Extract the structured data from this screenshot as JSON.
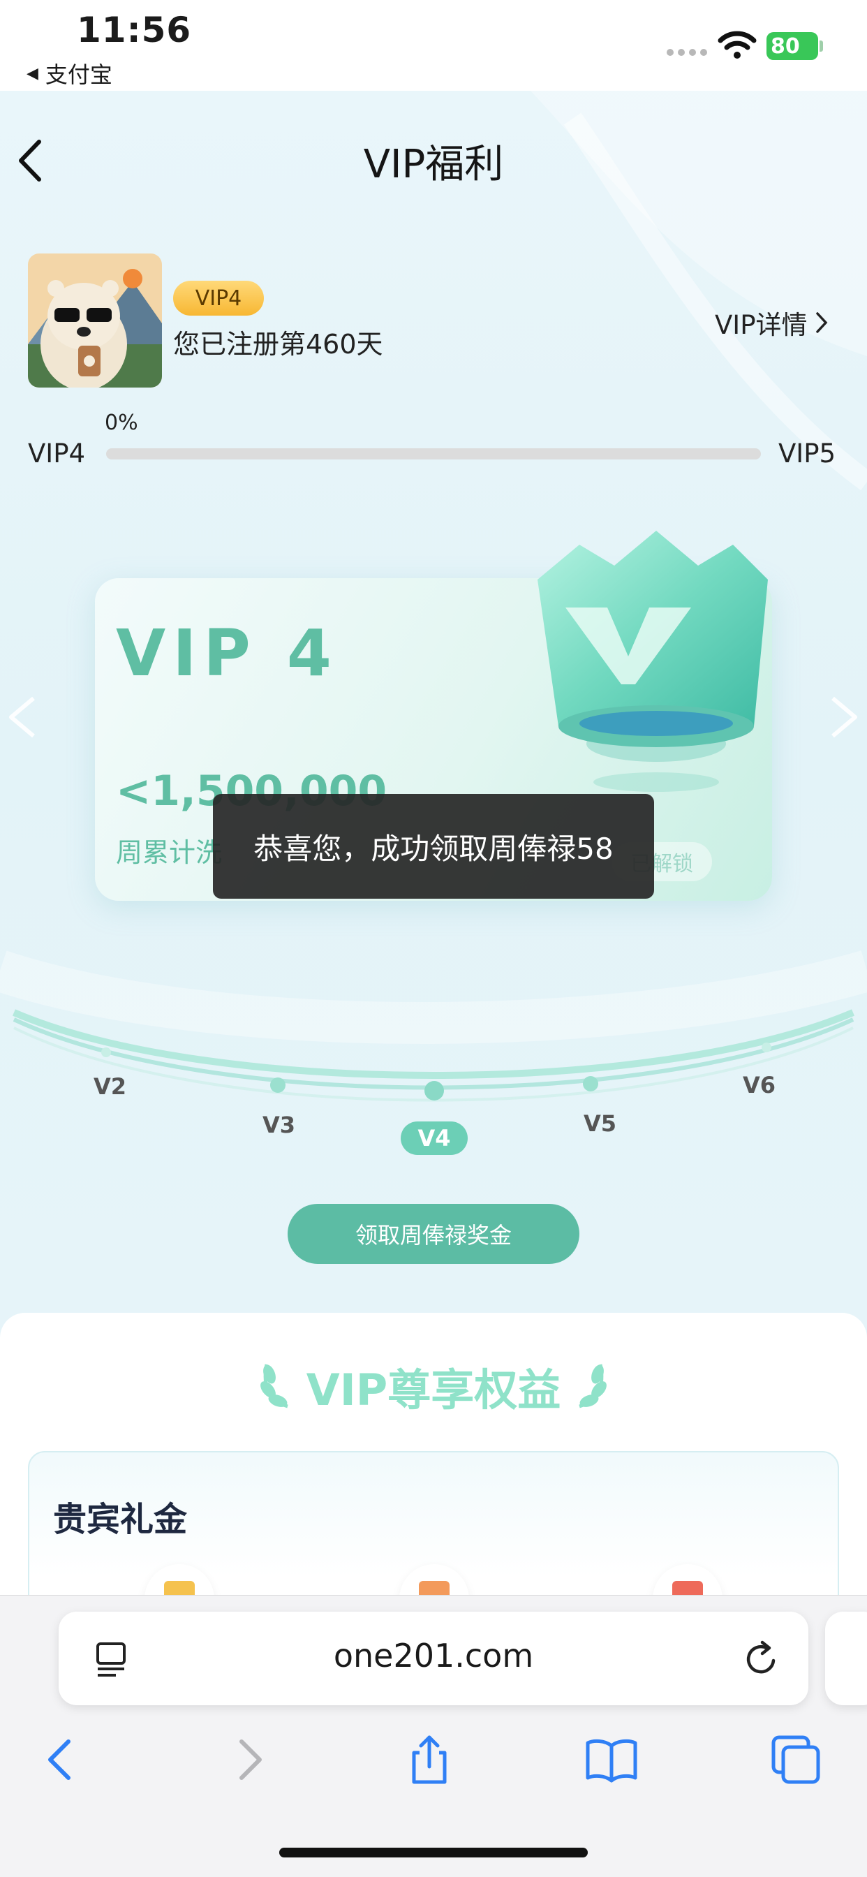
{
  "status_bar": {
    "time": "11:56",
    "back_app": "支付宝",
    "battery": "80",
    "battery_color": "#39c758"
  },
  "header": {
    "title": "VIP福利",
    "back_icon": "chevron-left-icon"
  },
  "profile": {
    "avatar": "bear-avatar",
    "vip_badge": "VIP4",
    "registered": "您已注册第460天",
    "vip_detail": "VIP详情"
  },
  "progress": {
    "percent_label": "0%",
    "percent": 0,
    "from_level": "VIP4",
    "to_level": "VIP5"
  },
  "vip_card": {
    "title": "VIP 4",
    "amount": "<1,500,000",
    "subtitle": "周累计洗",
    "status": "已解锁",
    "accent": "#5fbea3"
  },
  "toast": {
    "message": "恭喜您，成功领取周俸禄58"
  },
  "levels": {
    "items": [
      "V2",
      "V3",
      "V4",
      "V5",
      "V6"
    ],
    "current": "V4"
  },
  "claim_button": {
    "label": "领取周俸禄奖金"
  },
  "benefits": {
    "title": "VIP尊享权益",
    "section_title": "贵宾礼金"
  },
  "browser": {
    "url": "one201.com",
    "nav_icons": [
      "back-icon",
      "forward-icon",
      "share-icon",
      "bookmarks-icon",
      "tabs-icon"
    ]
  }
}
